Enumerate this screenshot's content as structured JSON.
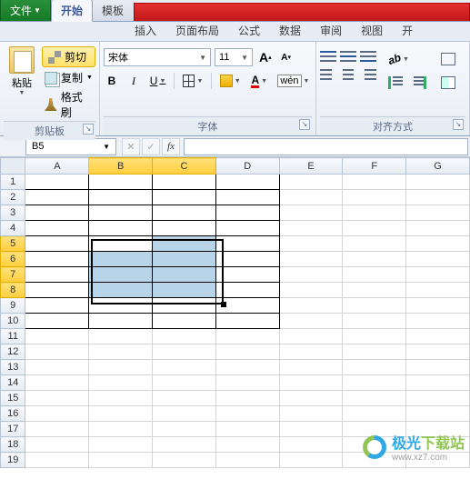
{
  "tabs": {
    "file": "文件",
    "home": "开始",
    "template": "模板",
    "insert": "插入",
    "layout": "页面布局",
    "formula": "公式",
    "data": "数据",
    "review": "审阅",
    "view": "视图",
    "more": "开"
  },
  "clipboard": {
    "paste": "粘贴",
    "cut": "剪切",
    "copy": "复制",
    "format_painter": "格式刷",
    "group": "剪贴板"
  },
  "font": {
    "name": "宋体",
    "size": "11",
    "bold": "B",
    "italic": "I",
    "underline": "U",
    "font_color_letter": "A",
    "increase": "A",
    "decrease": "A",
    "wen": "wén",
    "group": "字体"
  },
  "align": {
    "group": "对齐方式"
  },
  "formula_bar": {
    "name_box": "B5",
    "fx": "fx"
  },
  "columns": [
    "A",
    "B",
    "C",
    "D",
    "E",
    "F",
    "G"
  ],
  "rows": [
    "1",
    "2",
    "3",
    "4",
    "5",
    "6",
    "7",
    "8",
    "9",
    "10",
    "11",
    "12",
    "13",
    "14",
    "15",
    "16",
    "17",
    "18",
    "19"
  ],
  "watermark": {
    "t1": "极光",
    "t2": "下载站",
    "url": "www.xz7.com"
  }
}
